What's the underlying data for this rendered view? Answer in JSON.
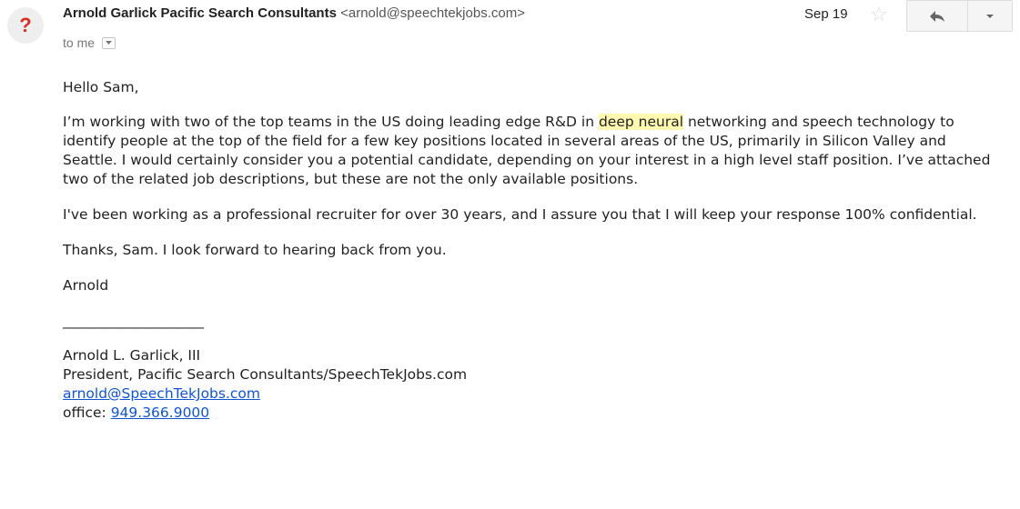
{
  "message": {
    "avatar": {
      "glyph": "?",
      "color": "#d93025"
    },
    "sender": {
      "name": "Arnold Garlick Pacific Search Consultants",
      "email": "<arnold@speechtekjobs.com>"
    },
    "date": "Sep 19",
    "recipient": "to me",
    "icons": {
      "star": "star-icon",
      "reply": "reply-arrow-icon",
      "more": "dropdown-caret-icon",
      "details": "details-caret-icon"
    },
    "body": {
      "greeting": "Hello Sam,",
      "p1_before": "I’m working with two of the top teams in the US doing leading edge R&D in ",
      "p1_highlight": "deep neural",
      "p1_after": " networking and speech technology to identify people at the top of the field for a few key positions located in several areas of the US, primarily in Silicon Valley and Seattle. I would certainly consider you a potential candidate, depending on your interest in a high level staff position. I’ve attached two of the related job descriptions, but these are not the only available positions.",
      "p2": "I've been working as a professional recruiter for over 30 years, and I assure you that I will keep your response 100% confidential.",
      "p3": "Thanks, Sam. I look forward to hearing back from you.",
      "signoff": "Arnold",
      "divider": "____________________"
    },
    "signature": {
      "name": "Arnold L. Garlick, III",
      "title": "President, Pacific Search Consultants/SpeechTekJobs.com",
      "email": "arnold@SpeechTekJobs.com",
      "office_label": "office: ",
      "office_phone": "949.366.9000"
    },
    "colors": {
      "highlight": "#fff8b0",
      "link": "#1155cc",
      "text": "#222222"
    }
  }
}
